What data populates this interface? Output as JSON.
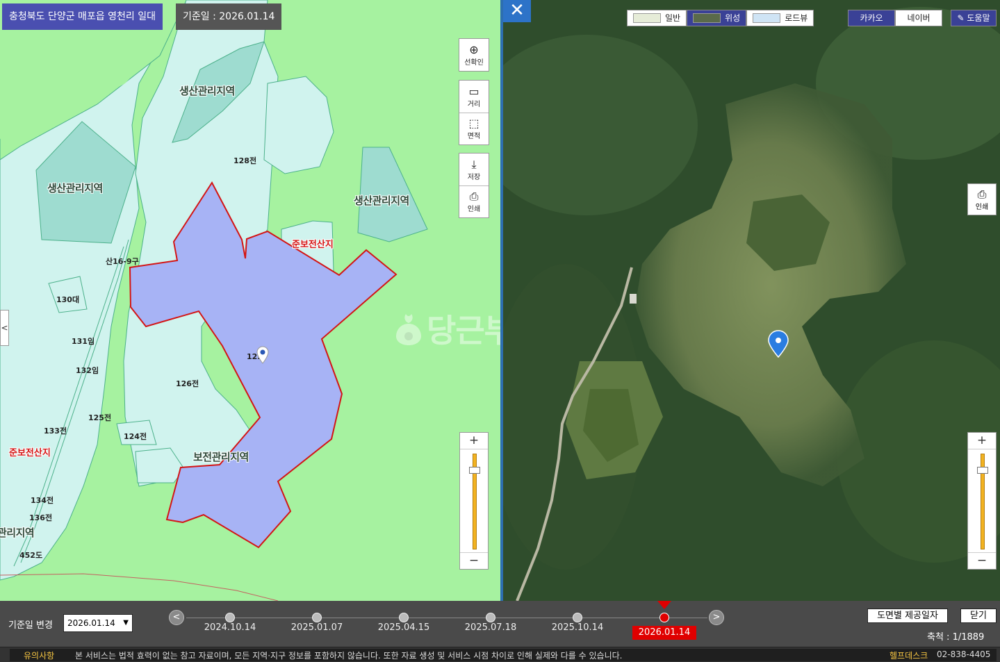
{
  "left_map": {
    "location_title": "충청북도 단양군 매포읍 영천리 일대",
    "reference_date": "기준일 : 2026.01.14",
    "zone_labels": [
      "생산관리지역",
      "생산관리지역",
      "생산관리지역",
      "보전관리지역",
      "관리지역"
    ],
    "red_labels": [
      "준보전산지",
      "준보전산지"
    ],
    "parcel_labels": [
      "128전",
      "산16-9구",
      "130대",
      "131임",
      "132임",
      "126전",
      "125전",
      "124전",
      "133전",
      "134전",
      "136전",
      "452도",
      "12..."
    ],
    "tools": {
      "selection": "선확인",
      "distance": "거리",
      "area": "면적",
      "save": "저장",
      "print": "인쇄"
    },
    "zoom": {
      "plus": "+",
      "minus": "−",
      "level": 0.85
    },
    "collapse_glyph": "<"
  },
  "right_map": {
    "close_glyph": "✕",
    "map_types": [
      {
        "label": "일반",
        "active": false
      },
      {
        "label": "위성",
        "active": true
      },
      {
        "label": "로드뷰",
        "active": false
      }
    ],
    "providers": [
      {
        "label": "카카오",
        "active": true
      },
      {
        "label": "네이버",
        "active": false
      }
    ],
    "help": "✎ 도움말",
    "print": "인쇄",
    "zoom": {
      "plus": "+",
      "minus": "−",
      "level": 0.85
    }
  },
  "watermark": "당근부동산",
  "timeline": {
    "label": "기준일 변경",
    "selected": "2026.01.14",
    "prev_glyph": "<",
    "next_glyph": ">",
    "dates": [
      "2024.10.14",
      "2025.01.07",
      "2025.04.15",
      "2025.07.18",
      "2025.10.14",
      "2026.01.14"
    ],
    "active_index": 5,
    "btn_provide_dates": "도면별 제공일자",
    "btn_close": "닫기",
    "scale": "축척 : 1/1889"
  },
  "notice": {
    "title": "유의사항",
    "text": "본 서비스는 법적 효력이 없는 참고 자료이며, 모든 지역·지구 정보를 포함하지 않습니다. 또한 자료 생성 및 서비스 시점 차이로 인해 실제와 다를 수 있습니다.",
    "helpdesk_label": "헬프데스크",
    "helpdesk_phone": "02-838-4405"
  },
  "colors": {
    "title_bg": "#4a4fb0",
    "forest_green": "#a6f2a0",
    "parcel_blue": "#a7b3f5",
    "boundary_red": "#d41414",
    "timeline_active": "#e00000",
    "accent_blue": "#2d73c8"
  }
}
